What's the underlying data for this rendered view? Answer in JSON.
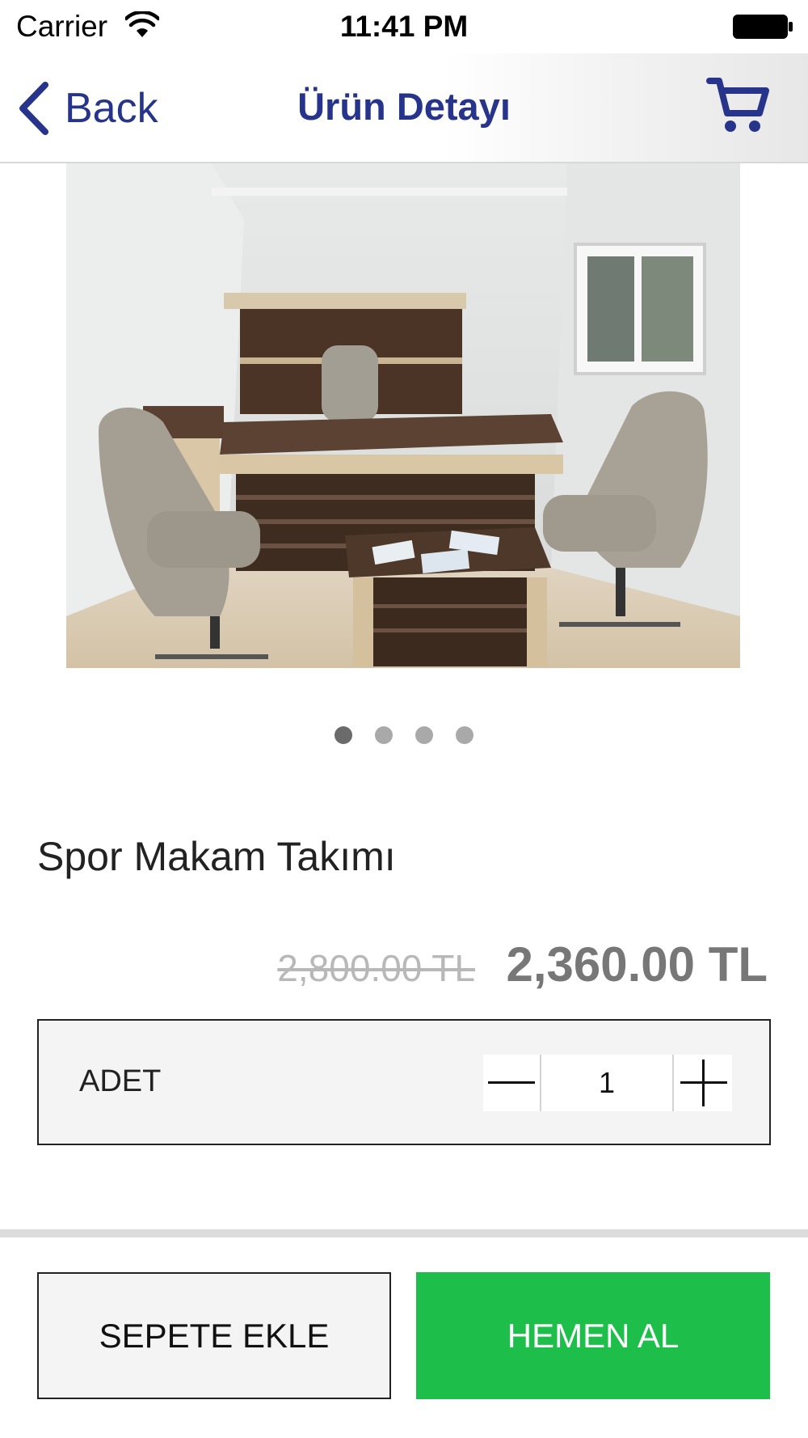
{
  "status_bar": {
    "carrier": "Carrier",
    "time": "11:41 PM",
    "icons": [
      "wifi-icon",
      "battery-icon"
    ]
  },
  "nav": {
    "back_label": "Back",
    "title": "Ürün Detayı",
    "cart_icon": "cart-icon",
    "accent_color": "#27348b"
  },
  "carousel": {
    "image_description": "office furniture set",
    "page_count": 4,
    "current_page": 1
  },
  "product": {
    "title": "Spor Makam Takımı",
    "old_price": "2,800.00 TL",
    "new_price": "2,360.00 TL"
  },
  "quantity": {
    "label": "ADET",
    "value": "1"
  },
  "actions": {
    "add_to_cart_label": "SEPETE EKLE",
    "buy_now_label": "HEMEN AL",
    "buy_now_color": "#1dbf4a"
  }
}
